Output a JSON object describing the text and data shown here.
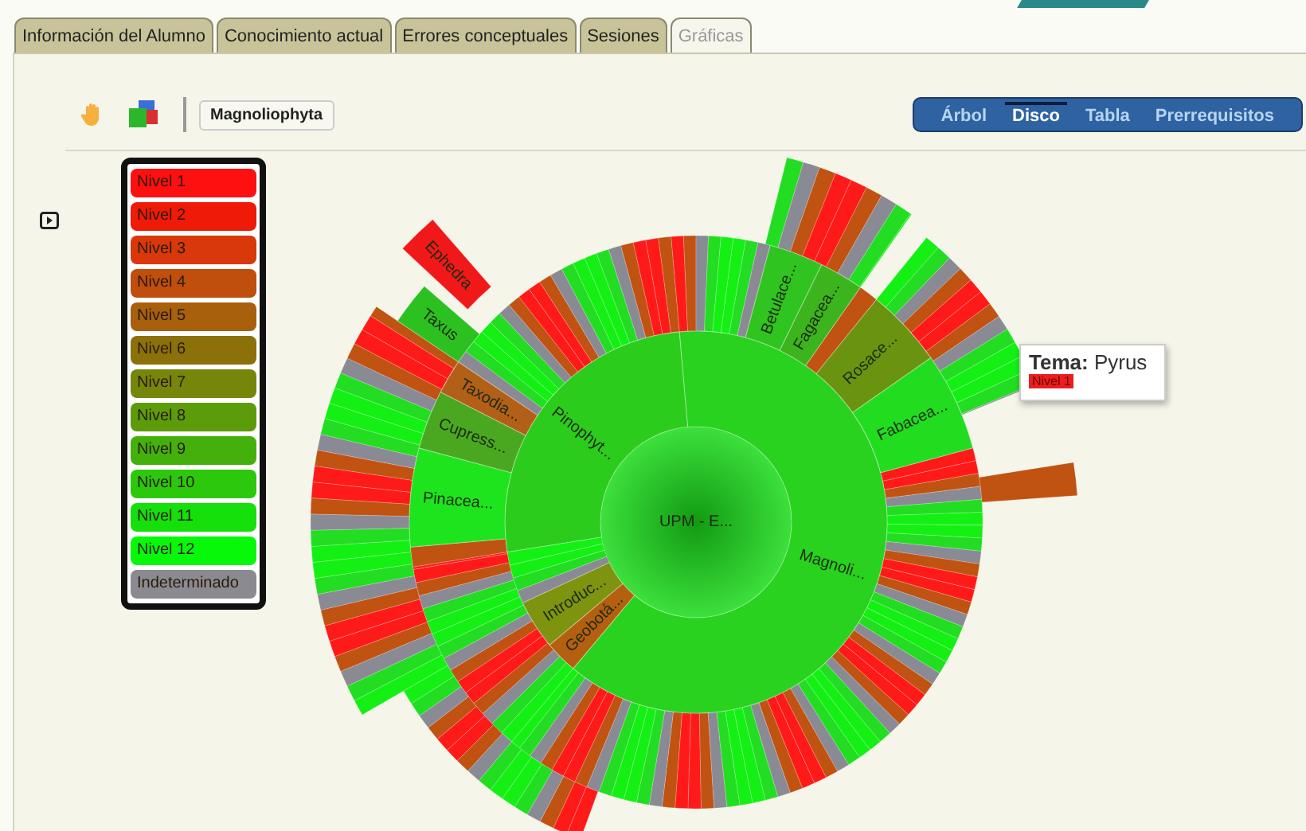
{
  "tabs": [
    {
      "label": "Información del Alumno",
      "selected": false
    },
    {
      "label": "Conocimiento actual",
      "selected": false
    },
    {
      "label": "Errores conceptuales",
      "selected": false
    },
    {
      "label": "Sesiones",
      "selected": false
    },
    {
      "label": "Gráficas",
      "selected": true
    }
  ],
  "toolbar": {
    "breadcrumb": "Magnoliophyta"
  },
  "views": [
    {
      "label": "Árbol",
      "selected": false
    },
    {
      "label": "Disco",
      "selected": true
    },
    {
      "label": "Tabla",
      "selected": false
    },
    {
      "label": "Prerrequisitos",
      "selected": false
    }
  ],
  "legend": [
    {
      "label": "Nivel 1",
      "color": "#ff1010"
    },
    {
      "label": "Nivel 2",
      "color": "#f01a08"
    },
    {
      "label": "Nivel 3",
      "color": "#d8380a"
    },
    {
      "label": "Nivel 4",
      "color": "#c04e0c"
    },
    {
      "label": "Nivel 5",
      "color": "#a8600c"
    },
    {
      "label": "Nivel 6",
      "color": "#8c700a"
    },
    {
      "label": "Nivel 7",
      "color": "#76860a"
    },
    {
      "label": "Nivel 8",
      "color": "#5c9c0a"
    },
    {
      "label": "Nivel 9",
      "color": "#44b00c"
    },
    {
      "label": "Nivel 10",
      "color": "#2cc80c"
    },
    {
      "label": "Nivel 11",
      "color": "#16e00c"
    },
    {
      "label": "Nivel 12",
      "color": "#08f80a"
    },
    {
      "label": "Indeterminado",
      "color": "#8a8a90"
    }
  ],
  "sunburst": {
    "root": {
      "label": "UPM - E...",
      "children": [
        {
          "label": "Magnoli...",
          "children": [
            {
              "label": "Betulace..."
            },
            {
              "label": "Fagacea..."
            },
            {
              "label": "Rosace..."
            },
            {
              "label": "Fabacea..."
            }
          ]
        },
        {
          "label": "Geobotá..."
        },
        {
          "label": "Introduc..."
        },
        {
          "label": "Pinophyt...",
          "children": [
            {
              "label": "Pinacea..."
            },
            {
              "label": "Cupress..."
            },
            {
              "label": "Taxodia..."
            },
            {
              "label": "Taxus"
            },
            {
              "label": "Ephedra"
            }
          ]
        }
      ]
    }
  },
  "tooltip": {
    "title": "Tema:",
    "value": "Pyrus",
    "badge": "Nivel 1"
  }
}
